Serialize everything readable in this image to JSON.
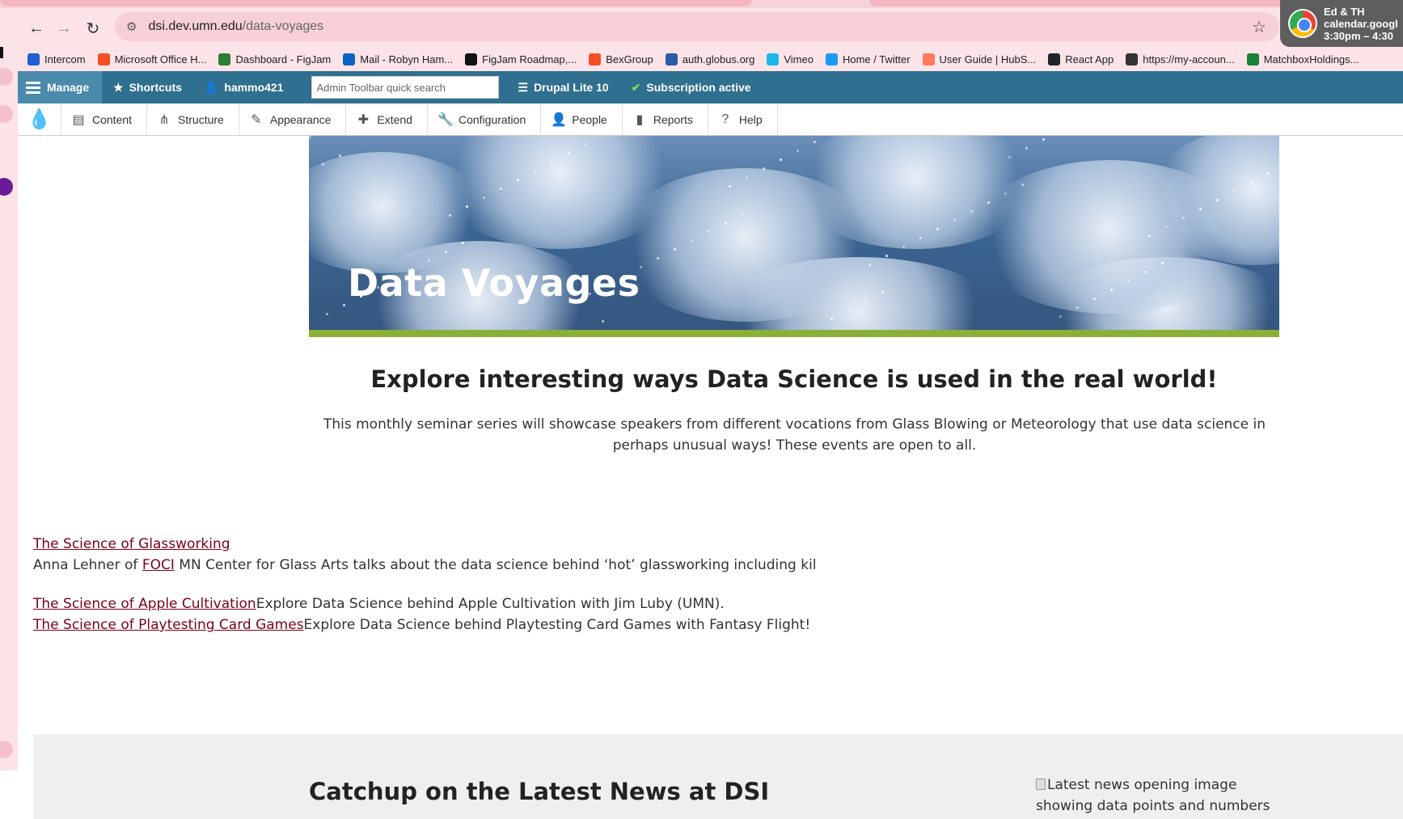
{
  "browser": {
    "url_host": "dsi.dev.umn.edu",
    "url_path": "/data-voyages"
  },
  "notification": {
    "line1": "Ed & TH",
    "line2": "calendar.googl",
    "line3": "3:30pm – 4:30"
  },
  "bookmarks": [
    {
      "label": "Intercom",
      "color": "#1f5fd1"
    },
    {
      "label": "Microsoft Office H...",
      "color": "#f25022"
    },
    {
      "label": "Dashboard - FigJam",
      "color": "#2e7d32"
    },
    {
      "label": "Mail - Robyn Ham...",
      "color": "#0a64c2"
    },
    {
      "label": "FigJam Roadmap,...",
      "color": "#111111"
    },
    {
      "label": "BexGroup",
      "color": "#f25022"
    },
    {
      "label": "auth.globus.org",
      "color": "#2b5ca8"
    },
    {
      "label": "Vimeo",
      "color": "#1ab7ea"
    },
    {
      "label": "Home / Twitter",
      "color": "#1d9bf0"
    },
    {
      "label": "User Guide | HubS...",
      "color": "#ff7a59"
    },
    {
      "label": "React App",
      "color": "#20232a"
    },
    {
      "label": "https://my-accoun...",
      "color": "#333333"
    },
    {
      "label": "MatchboxHoldings...",
      "color": "#188038"
    }
  ],
  "admin": {
    "manage": "Manage",
    "shortcuts": "Shortcuts",
    "user": "hammo421",
    "search_placeholder": "Admin Toolbar quick search",
    "site": "Drupal Lite 10",
    "subscription": "Subscription active"
  },
  "tray": {
    "content": "Content",
    "structure": "Structure",
    "appearance": "Appearance",
    "extend": "Extend",
    "configuration": "Configuration",
    "people": "People",
    "reports": "Reports",
    "help": "Help"
  },
  "hero": {
    "title": "Data Voyages"
  },
  "intro": {
    "title": "Explore interesting ways Data Science is used in the real world!",
    "body": "This monthly seminar series will showcase speakers from different vocations from Glass Blowing or Meteorology that use data science in perhaps unusual ways! These events are open to all."
  },
  "events": {
    "e1_link": "The Science of Glassworking",
    "e1_pre": "Anna Lehner of ",
    "e1_inline_link": "FOCI",
    "e1_post": " MN Center for Glass Arts talks about the data science behind ‘hot’ glassworking including kil",
    "e2_link": "The Science of Apple Cultivation",
    "e2_desc": "Explore Data Science behind Apple Cultivation with Jim Luby (UMN).",
    "e3_link": "The Science of Playtesting Card Games",
    "e3_desc": "Explore Data Science behind Playtesting Card Games with Fantasy Flight!"
  },
  "news": {
    "title": "Catchup on the Latest News at DSI",
    "image_alt": "Latest news opening image showing data points and numbers"
  },
  "colors": {
    "admin_bar": "#2f6f8f",
    "hero_accent": "#8ab03a",
    "link": "#7a0019"
  }
}
